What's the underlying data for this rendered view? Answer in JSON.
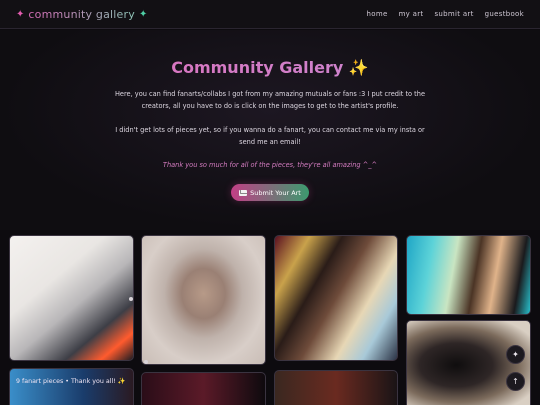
{
  "header": {
    "brand": "community gallery",
    "spark_left": "✦",
    "spark_right": "✦",
    "nav": [
      "home",
      "my art",
      "submit art",
      "guestbook"
    ]
  },
  "hero": {
    "title": "Community Gallery",
    "title_spark": "✨",
    "paragraph1": "Here, you can find fanarts/collabs I got from my amazing mutuals or fans :3 I put credit to the creators, all you have to do is click on the images to get to the artist's profile.",
    "paragraph2": "I didn't get lots of pieces yet, so if you wanna do a fanart, you can contact me via my insta or send me an email!",
    "thanks": "Thank you so much for all of the pieces, they're all amazing ^_^",
    "submit_label": "Submit Your Art"
  },
  "gallery": {
    "tag": "9 fanart pieces • Thank you all! ✨"
  },
  "fabs": {
    "sparkle": "✦",
    "to_top": "↑"
  },
  "colors": {
    "accent_pink": "#d86ab8",
    "accent_green": "#4fd0a6",
    "background": "#0d0b0f"
  }
}
